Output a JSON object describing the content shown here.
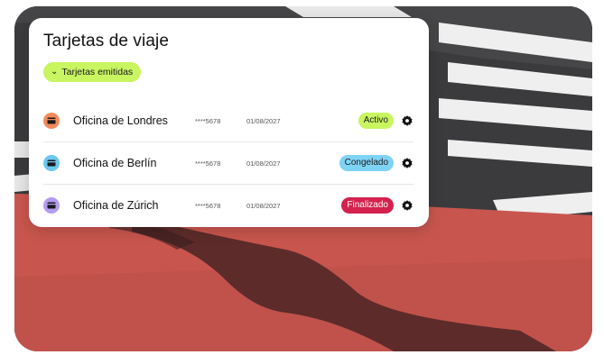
{
  "card": {
    "title": "Tarjetas de viaje",
    "filter_chip": {
      "label": "Tarjetas emitidas",
      "icon": "chevron-down-icon"
    }
  },
  "cards": [
    {
      "name": "Oficina de Londres",
      "number": "****5678",
      "date": "01/08/2027",
      "status": "Activo",
      "icon_color": "#f28a5c",
      "status_bg": "#c8f560",
      "status_fg": "#1a1a1a"
    },
    {
      "name": "Oficina de Berlín",
      "number": "****5678",
      "date": "01/08/2027",
      "status": "Congelado",
      "icon_color": "#6cc8ee",
      "status_bg": "#7fd3f5",
      "status_fg": "#1a1a1a"
    },
    {
      "name": "Oficina de Zúrich",
      "number": "****5678",
      "date": "01/08/2027",
      "status": "Finalizado",
      "icon_color": "#b49cf0",
      "status_bg": "#d4214d",
      "status_fg": "#ffffff"
    }
  ],
  "colors": {
    "accent": "#c8f560",
    "road": "#3a3a3c",
    "bike_lane": "#c9584f",
    "stripes": "#f2f2f2"
  }
}
